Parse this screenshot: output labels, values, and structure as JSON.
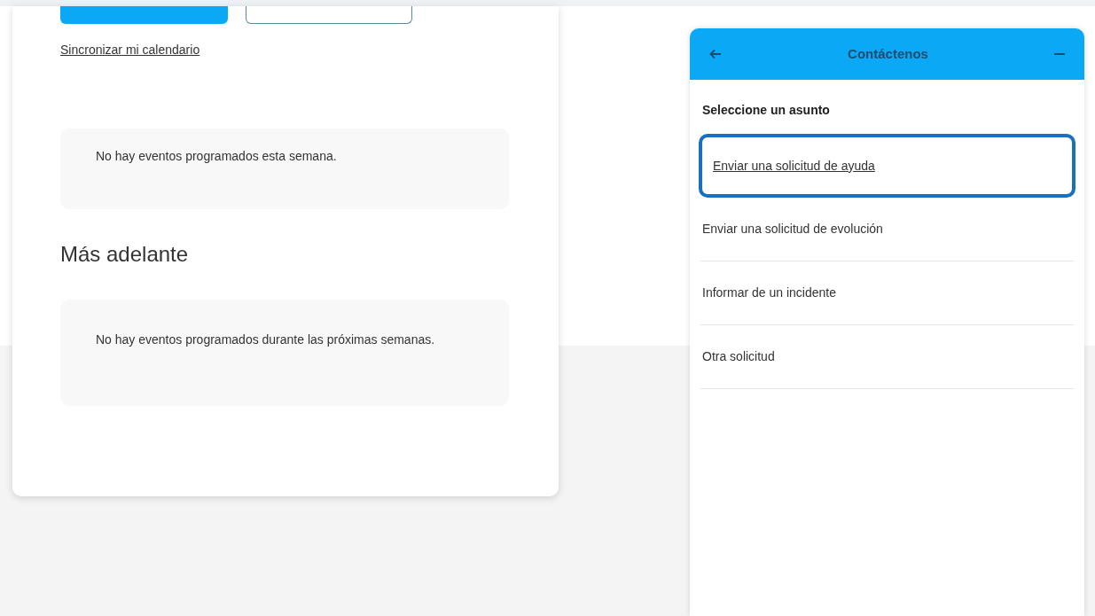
{
  "calendar": {
    "sync_link": "Sincronizar mi calendario",
    "this_week": {
      "message": "No hay eventos programados esta semana."
    },
    "later": {
      "heading": "Más adelante",
      "message": "No hay eventos programados durante las próximas semanas."
    }
  },
  "contact_panel": {
    "title": "Contáctenos",
    "prompt": "Seleccione un asunto",
    "subjects": [
      {
        "label": "Enviar una solicitud de ayuda",
        "selected": true
      },
      {
        "label": "Enviar una solicitud de evolución",
        "selected": false
      },
      {
        "label": "Informar de un incidente",
        "selected": false
      },
      {
        "label": "Otra solicitud",
        "selected": false
      }
    ]
  }
}
